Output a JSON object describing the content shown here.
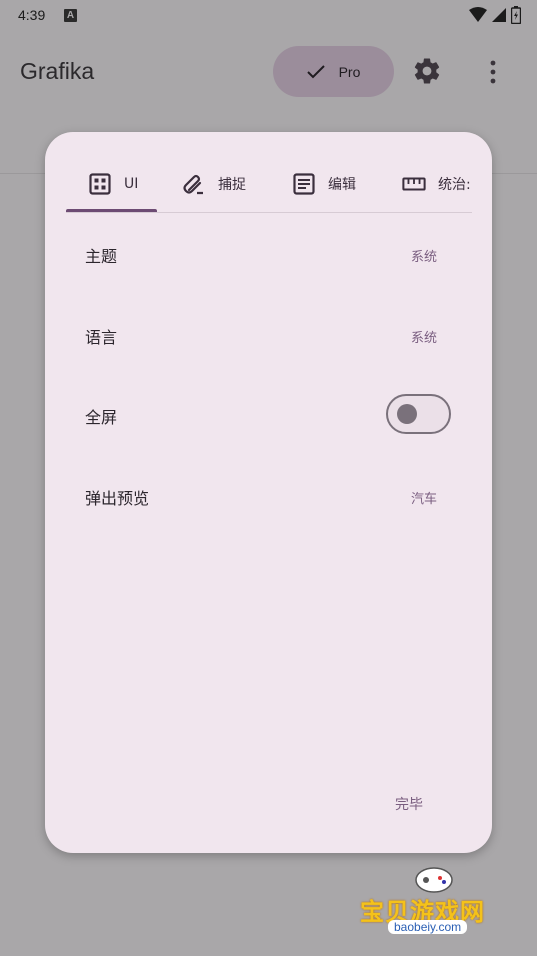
{
  "status_bar": {
    "time": "4:39",
    "notification_letter": "A"
  },
  "app_bar": {
    "title": "Grafika",
    "pro_label": "Pro"
  },
  "dialog": {
    "tabs": [
      {
        "label": "UI",
        "icon": "grid-icon"
      },
      {
        "label": "捕捉",
        "icon": "paperclip-icon"
      },
      {
        "label": "编辑",
        "icon": "article-icon"
      },
      {
        "label": "统治:",
        "icon": "ruler-icon"
      }
    ],
    "selected_tab": "UI",
    "rows": [
      {
        "label": "主题",
        "value": "系统"
      },
      {
        "label": "语言",
        "value": "系统"
      },
      {
        "label": "全屏",
        "toggle": false
      },
      {
        "label": "弹出预览",
        "value": "汽车"
      }
    ],
    "done_label": "完毕"
  },
  "watermark": {
    "text": "宝贝游戏网",
    "url": "baobeiy.com"
  },
  "colors": {
    "accent": "#6d4b73",
    "dialog_bg": "#f1e6ee",
    "scrim": "#a9a7a9"
  }
}
